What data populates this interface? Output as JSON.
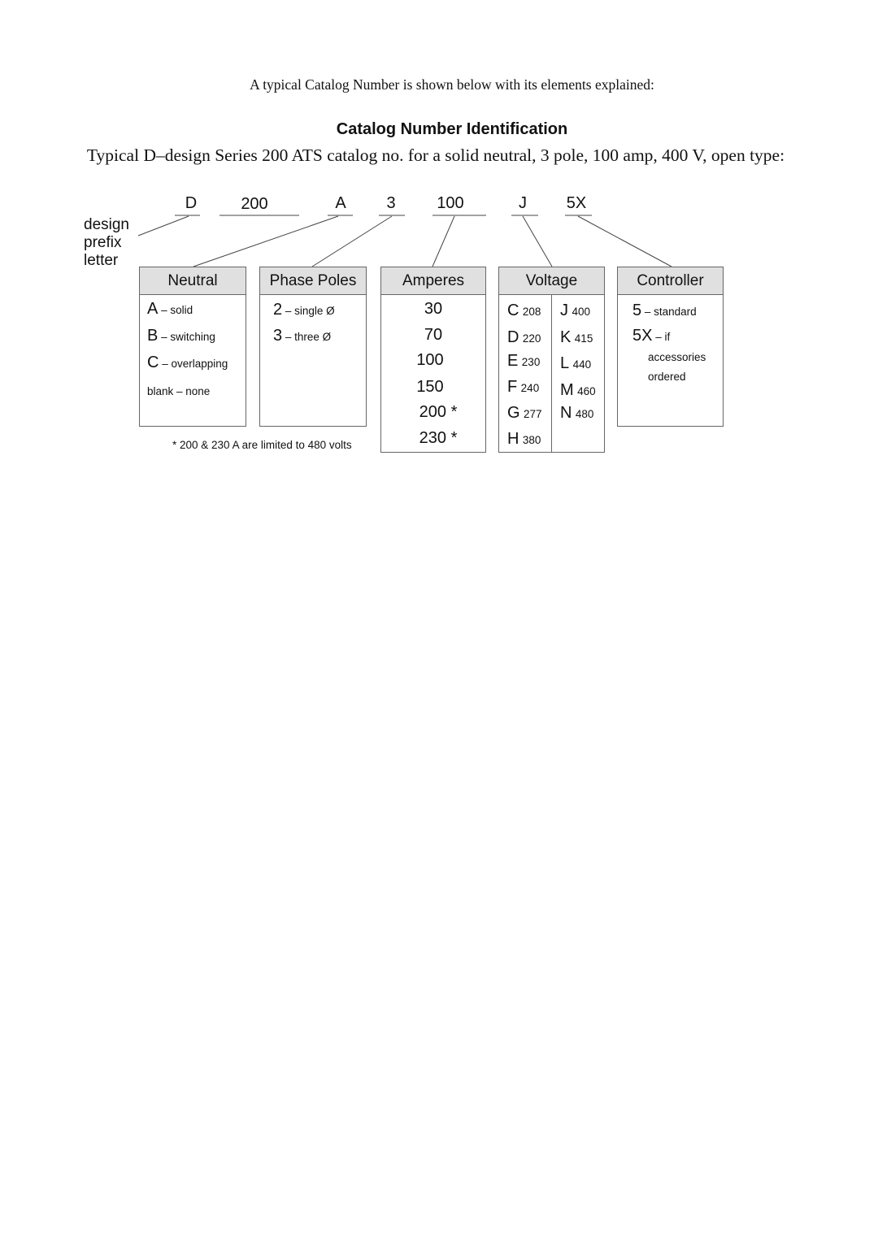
{
  "intro": "A typical Catalog Number is shown below with its elements explained:",
  "title": "Catalog Number Identification",
  "subtitle": "Typical D–design Series 200 ATS catalog no. for a solid neutral, 3 pole, 100 amp, 400 V, open type:",
  "catalog_codes": [
    "D",
    "200",
    "A",
    "3",
    "100",
    "J",
    "5X"
  ],
  "prefix_label": [
    "design",
    "prefix",
    "letter"
  ],
  "boxes": {
    "neutral": {
      "title": "Neutral",
      "items": [
        {
          "code": "A",
          "desc": " – solid"
        },
        {
          "code": "B",
          "desc": " – switching"
        },
        {
          "code": "C",
          "desc": " – overlapping"
        },
        {
          "code": "",
          "desc": "blank – none"
        }
      ]
    },
    "phase_poles": {
      "title": "Phase Poles",
      "items": [
        {
          "code": "2",
          "desc": " – single Ø"
        },
        {
          "code": "3",
          "desc": " – three Ø"
        }
      ]
    },
    "amperes": {
      "title": "Amperes",
      "items": [
        "30",
        "70",
        "100",
        "150",
        "200 *",
        "230 *"
      ]
    },
    "voltage": {
      "title": "Voltage",
      "left": [
        {
          "code": "C",
          "value": "208"
        },
        {
          "code": "D",
          "value": "220"
        },
        {
          "code": "E",
          "value": "230"
        },
        {
          "code": "F",
          "value": "240"
        },
        {
          "code": "G",
          "value": "277"
        },
        {
          "code": "H",
          "value": "380"
        }
      ],
      "right": [
        {
          "code": "J",
          "value": "400"
        },
        {
          "code": "K",
          "value": "415"
        },
        {
          "code": "L",
          "value": "440"
        },
        {
          "code": "M",
          "value": "460"
        },
        {
          "code": "N",
          "value": "480"
        }
      ]
    },
    "controller": {
      "title": "Controller",
      "items": [
        {
          "code": "5",
          "desc": " – standard"
        },
        {
          "code": "5X",
          "desc": " – if"
        }
      ],
      "continuation": [
        "accessories",
        "ordered"
      ]
    }
  },
  "footnote": "* 200 & 230 A are limited to 480 volts"
}
